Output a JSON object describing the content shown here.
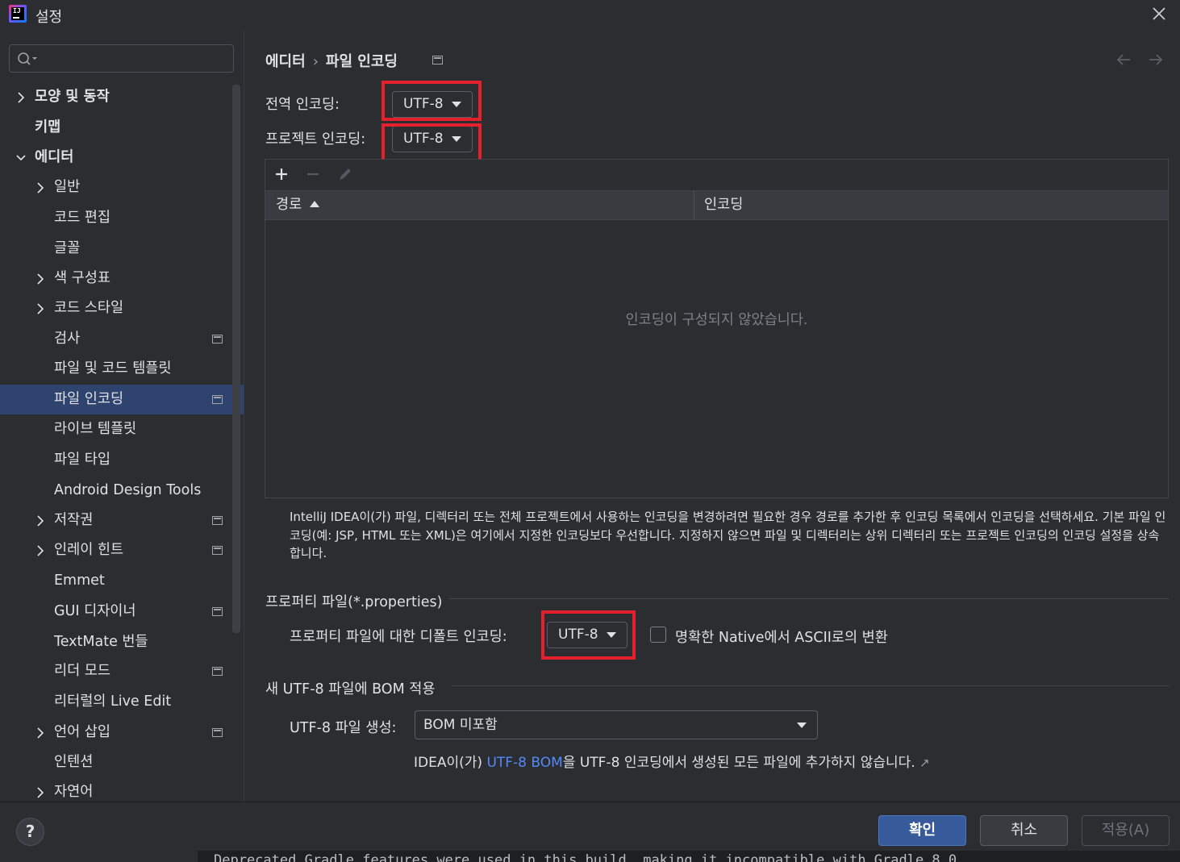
{
  "window": {
    "title": "설정"
  },
  "sidebar": {
    "search_placeholder": "",
    "items": [
      {
        "label": "모양 및 동작",
        "level": 0,
        "expandable": true,
        "expanded": false,
        "bold": true,
        "project_icon": false
      },
      {
        "label": "키맵",
        "level": 0,
        "expandable": false,
        "bold": true,
        "project_icon": false
      },
      {
        "label": "에디터",
        "level": 0,
        "expandable": true,
        "expanded": true,
        "bold": true,
        "project_icon": false
      },
      {
        "label": "일반",
        "level": 1,
        "expandable": true,
        "expanded": false,
        "project_icon": false
      },
      {
        "label": "코드 편집",
        "level": 1,
        "expandable": false,
        "project_icon": false
      },
      {
        "label": "글꼴",
        "level": 1,
        "expandable": false,
        "project_icon": false
      },
      {
        "label": "색 구성표",
        "level": 1,
        "expandable": true,
        "expanded": false,
        "project_icon": false
      },
      {
        "label": "코드 스타일",
        "level": 1,
        "expandable": true,
        "expanded": false,
        "project_icon": false
      },
      {
        "label": "검사",
        "level": 1,
        "expandable": false,
        "project_icon": true
      },
      {
        "label": "파일 및 코드 템플릿",
        "level": 1,
        "expandable": false,
        "project_icon": false
      },
      {
        "label": "파일 인코딩",
        "level": 1,
        "expandable": false,
        "project_icon": true,
        "selected": true
      },
      {
        "label": "라이브 템플릿",
        "level": 1,
        "expandable": false,
        "project_icon": false
      },
      {
        "label": "파일 타입",
        "level": 1,
        "expandable": false,
        "project_icon": false
      },
      {
        "label": "Android Design Tools",
        "level": 1,
        "expandable": false,
        "project_icon": false
      },
      {
        "label": "저작권",
        "level": 1,
        "expandable": true,
        "expanded": false,
        "project_icon": true
      },
      {
        "label": "인레이 힌트",
        "level": 1,
        "expandable": true,
        "expanded": false,
        "project_icon": true
      },
      {
        "label": "Emmet",
        "level": 1,
        "expandable": false,
        "project_icon": false
      },
      {
        "label": "GUI 디자이너",
        "level": 1,
        "expandable": false,
        "project_icon": true
      },
      {
        "label": "TextMate 번들",
        "level": 1,
        "expandable": false,
        "project_icon": false
      },
      {
        "label": "리더 모드",
        "level": 1,
        "expandable": false,
        "project_icon": true
      },
      {
        "label": "리터럴의 Live Edit",
        "level": 1,
        "expandable": false,
        "project_icon": false
      },
      {
        "label": "언어 삽입",
        "level": 1,
        "expandable": true,
        "expanded": false,
        "project_icon": true
      },
      {
        "label": "인텐션",
        "level": 1,
        "expandable": false,
        "project_icon": false
      },
      {
        "label": "자연어",
        "level": 1,
        "expandable": true,
        "expanded": false,
        "project_icon": false
      }
    ]
  },
  "breadcrumb": {
    "parent": "에디터",
    "separator": "›",
    "current": "파일 인코딩"
  },
  "encoding": {
    "global_label": "전역 인코딩:",
    "global_value": "UTF-8",
    "project_label": "프로젝트 인코딩:",
    "project_value": "UTF-8"
  },
  "table": {
    "columns": [
      "경로",
      "인코딩"
    ],
    "empty_text": "인코딩이 구성되지 않았습니다."
  },
  "help_text": "IntelliJ IDEA이(가) 파일, 디렉터리 또는 전체 프로젝트에서 사용하는 인코딩을 변경하려면 필요한 경우 경로를 추가한 후 인코딩 목록에서 인코딩을 선택하세요. 기본 파일 인코딩(예: JSP, HTML 또는 XML)은 여기에서 지정한 인코딩보다 우선합니다. 지정하지 않으면 파일 및 디렉터리는 상위 디렉터리 또는 프로젝트 인코딩의 인코딩 설정을 상속합니다.",
  "properties": {
    "section_title": "프로퍼티 파일(*.properties)",
    "default_label": "프로퍼티 파일에 대한 디폴트 인코딩:",
    "default_value": "UTF-8",
    "native_ascii_label": "명확한 Native에서 ASCII로의 변환",
    "native_ascii_checked": false
  },
  "bom": {
    "section_title": "새 UTF-8 파일에 BOM 적용",
    "create_label": "UTF-8 파일 생성:",
    "create_value": "BOM 미포함",
    "note_prefix": "IDEA이(가) ",
    "note_link": "UTF-8 BOM",
    "note_suffix": "을 UTF-8 인코딩에서 생성된 모든 파일에 추가하지 않습니다.",
    "note_arrow": "↗"
  },
  "footer": {
    "help": "?",
    "ok": "확인",
    "cancel": "취소",
    "apply": "적용(A)"
  },
  "console_peek": "Deprecated Gradle features were used in this build, making it incompatible with Gradle 8.0",
  "colors": {
    "background": "#2b2d30",
    "selection": "#2e436e",
    "accent_link": "#548af7",
    "highlight_box": "#e3202b",
    "primary_button": "#375a9a"
  }
}
